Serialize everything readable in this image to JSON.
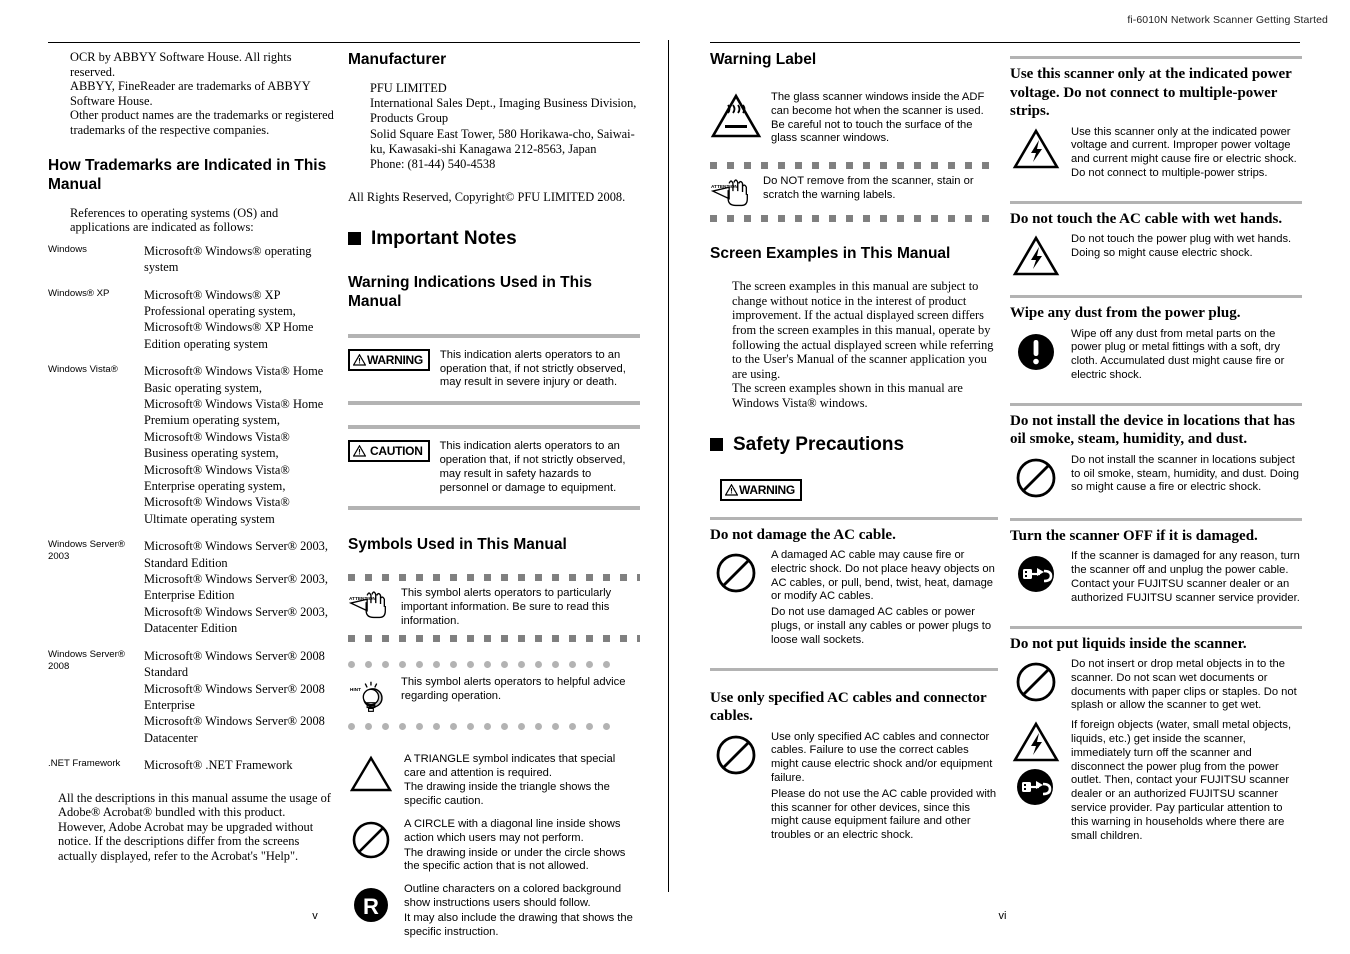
{
  "header": {
    "title": "fi-6010N Network Scanner Getting Started"
  },
  "page_numbers": {
    "left": "v",
    "right": "vi"
  },
  "left_page": {
    "col1": {
      "intro": "OCR by ABBYY Software House. All rights reserved.\nABBYY, FineReader are trademarks of ABBYY Software House.\nOther product names are the trademarks or registered trademarks of the respective companies.",
      "heading_trademarks": "How Trademarks are Indicated in This Manual",
      "trademark_intro": "References to operating systems (OS) and applications are indicated as follows:",
      "os_table": [
        {
          "key": "Windows",
          "value": "Microsoft® Windows® operating system"
        },
        {
          "key": "Windows® XP",
          "value": "Microsoft® Windows® XP Professional operating system,\nMicrosoft® Windows® XP Home Edition operating system"
        },
        {
          "key": "Windows Vista®",
          "value": "Microsoft® Windows Vista® Home Basic operating system,\nMicrosoft® Windows Vista® Home Premium operating system,\nMicrosoft® Windows Vista® Business operating system,\nMicrosoft® Windows Vista® Enterprise operating system,\nMicrosoft® Windows Vista® Ultimate operating system"
        },
        {
          "key": "Windows Server® 2003",
          "value": "Microsoft® Windows Server® 2003, Standard Edition\nMicrosoft® Windows Server® 2003, Enterprise Edition\nMicrosoft® Windows Server® 2003, Datacenter Edition"
        },
        {
          "key": "Windows Server® 2008",
          "value": "Microsoft® Windows Server® 2008 Standard\nMicrosoft® Windows Server® 2008 Enterprise\nMicrosoft® Windows Server® 2008 Datacenter"
        },
        {
          "key": ".NET Framework",
          "value": "Microsoft® .NET Framework"
        }
      ],
      "acrobat_note": "All the descriptions in this manual assume the usage of Adobe® Acrobat® bundled with this product. However, Adobe Acrobat may be upgraded without notice. If the descriptions differ from the screens actually displayed, refer to the Acrobat's \"Help\"."
    },
    "col2": {
      "heading_manufacturer": "Manufacturer",
      "manufacturer_address": "PFU LIMITED\nInternational Sales Dept., Imaging Business Division, Products Group\nSolid Square East Tower, 580 Horikawa-cho, Saiwai-ku, Kawasaki-shi Kanagawa 212-8563, Japan\nPhone: (81-44) 540-4538",
      "copyright": "All Rights Reserved, Copyright© PFU LIMITED 2008.",
      "heading_important_notes": "Important Notes",
      "heading_warning_indications": "Warning Indications Used in This Manual",
      "warning_label": "WARNING",
      "warning_text": "This indication alerts operators to an operation that, if not strictly observed, may result in severe injury or death.",
      "caution_label": "CAUTION",
      "caution_text": "This indication alerts operators to an operation that, if not strictly observed, may result in safety hazards to personnel or damage to equipment.",
      "heading_symbols": "Symbols Used in This Manual",
      "attention_text": "This symbol alerts operators to particularly important information. Be sure to read this information.",
      "attention_icon_label": "ATTENTION",
      "hint_text": "This symbol alerts operators to helpful advice regarding operation.",
      "hint_icon_label": "HINT",
      "symbols": [
        {
          "icon": "triangle-icon",
          "lines": [
            "A TRIANGLE symbol indicates that special care and attention is required.",
            "The drawing inside the triangle shows the specific caution."
          ]
        },
        {
          "icon": "prohibition-circle-icon",
          "lines": [
            "A CIRCLE with a diagonal line inside shows action which users may not perform.",
            "The drawing inside or under the circle shows the specific action that is not allowed."
          ]
        },
        {
          "icon": "filled-circle-r-icon",
          "lines": [
            "Outline characters on a colored background show instructions users should follow.",
            "It may also include the drawing that shows the specific instruction."
          ]
        }
      ]
    }
  },
  "right_page": {
    "col1": {
      "heading_warning_label": "Warning Label",
      "hot_surface_text": "The glass scanner windows inside the ADF can become hot when the scanner is used. Be careful not to touch the surface of the glass scanner windows.",
      "attention_icon_label": "ATTENTION",
      "attention_text": "Do NOT remove from the scanner, stain or scratch the warning labels.",
      "heading_screen_examples": "Screen Examples in This Manual",
      "screen_examples_text": "The screen examples in this manual are subject to change without notice in the interest of product improvement. If the actual displayed screen differs from the screen examples in this manual, operate by following the actual displayed screen while referring to the User's Manual of the scanner application you are using.\nThe screen examples shown in this manual are Windows Vista® windows.",
      "heading_safety": "Safety Precautions",
      "warning_label": "WARNING",
      "items": [
        {
          "title": "Do not damage the AC cable.",
          "icon": "prohibition-circle-icon",
          "paragraphs": [
            "A damaged AC cable may cause fire or electric shock. Do not place heavy objects on AC cables, or pull, bend, twist, heat, damage or modify AC cables.",
            "Do not use damaged AC cables or power plugs, or install any cables or power plugs to loose wall sockets."
          ]
        },
        {
          "title": "Use only specified AC cables and connector cables.",
          "icon": "prohibition-circle-icon",
          "paragraphs": [
            "Use only specified AC cables and connector cables. Failure to use the correct cables might cause electric shock and/or equipment failure.",
            "Please do not use the AC cable provided with this scanner for other devices, since this might cause equipment failure and other troubles or an electric shock."
          ]
        }
      ]
    },
    "col2": {
      "items": [
        {
          "title": "Use this scanner only at the indicated power voltage. Do not connect to multiple-power strips.",
          "icon": "electric-shock-triangle-icon",
          "paragraphs": [
            "Use this scanner only at the indicated power voltage and current. Improper power voltage and current might cause fire or electric shock. Do not connect to multiple-power strips."
          ]
        },
        {
          "title": "Do not touch the AC cable with wet hands.",
          "icon": "electric-shock-triangle-icon",
          "paragraphs": [
            "Do not touch the power plug with wet hands. Doing so might cause electric shock."
          ]
        },
        {
          "title": "Wipe any dust from the power plug.",
          "icon": "exclamation-circle-icon",
          "paragraphs": [
            "Wipe off any dust from metal parts on the power plug or metal fittings with a soft, dry cloth. Accumulated dust might cause fire or electric shock."
          ]
        },
        {
          "title": "Do not install the device in locations that has oil smoke, steam, humidity, and dust.",
          "icon": "prohibition-circle-icon",
          "paragraphs": [
            "Do not install the scanner in locations subject to oil smoke, steam, humidity, and dust. Doing so might cause a fire or electric shock."
          ]
        },
        {
          "title": "Turn the scanner OFF if it is damaged.",
          "icon": "unplug-circle-icon",
          "paragraphs": [
            "If the scanner is damaged for any reason, turn the scanner off and unplug the power cable. Contact your FUJITSU scanner dealer or an authorized FUJITSU scanner service provider."
          ]
        },
        {
          "title": "Do not put liquids inside the scanner.",
          "icon": "prohibition-circle-icon",
          "paragraphs": [
            "Do not insert or drop metal objects in to the scanner. Do not scan wet documents or documents with paper clips or staples. Do not splash or allow the scanner to get wet."
          ],
          "second_icon": "electric-shock-triangle-icon",
          "third_icon": "unplug-circle-icon",
          "second_paragraphs": [
            "If foreign objects (water, small metal objects, liquids, etc.) get inside the scanner, immediately turn off the scanner and disconnect the power plug from the power outlet. Then, contact your FUJITSU scanner dealer or an authorized FUJITSU scanner service provider. Pay particular attention to this warning in households where there are small children."
          ]
        }
      ]
    }
  },
  "colors": {
    "grey_rule": "#b3b3b3",
    "text": "#000000",
    "background": "#ffffff"
  }
}
